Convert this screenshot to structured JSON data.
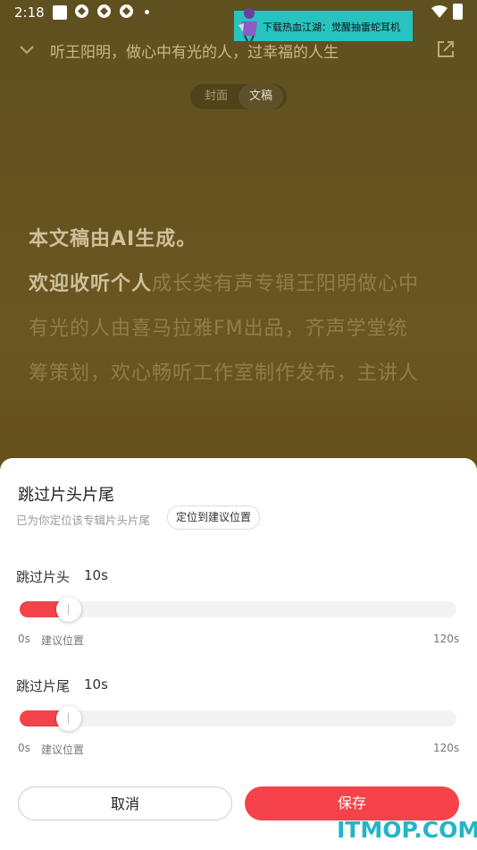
{
  "status_bar": {
    "time": "2:18"
  },
  "ad": {
    "text": "下载热血江湖：觉醒抽雷蛇耳机"
  },
  "header": {
    "title": "听王阳明，做心中有光的人，过幸福的人生"
  },
  "view_toggle": {
    "cover": "封面",
    "transcript": "文稿",
    "selected": "文稿"
  },
  "transcript": {
    "line1": "本文稿由AI生成。",
    "line2_highlight": "欢迎收听个人",
    "line2_rest": "成长类有声专辑王阳明做心中",
    "line3": "有光的人由喜马拉雅FM出品，齐声学堂统",
    "line4": "筹策划，欢心畅听工作室制作发布，主讲人"
  },
  "sheet": {
    "title": "跳过片头片尾",
    "subtitle": "已为你定位该专辑片头片尾",
    "locate_button": "定位到建议位置",
    "intro": {
      "label": "跳过片头",
      "value": "10s",
      "value_num": 10,
      "max": 120,
      "min_label": "0s",
      "suggest_label": "建议位置",
      "max_label": "120s"
    },
    "outro": {
      "label": "跳过片尾",
      "value": "10s",
      "value_num": 10,
      "max": 120,
      "min_label": "0s",
      "suggest_label": "建议位置",
      "max_label": "120s"
    },
    "cancel": "取消",
    "save": "保存"
  },
  "watermark": "ITMOP.COM",
  "colors": {
    "accent": "#f5424a",
    "background": "#5f5020",
    "watermark": "#21b6c6"
  }
}
